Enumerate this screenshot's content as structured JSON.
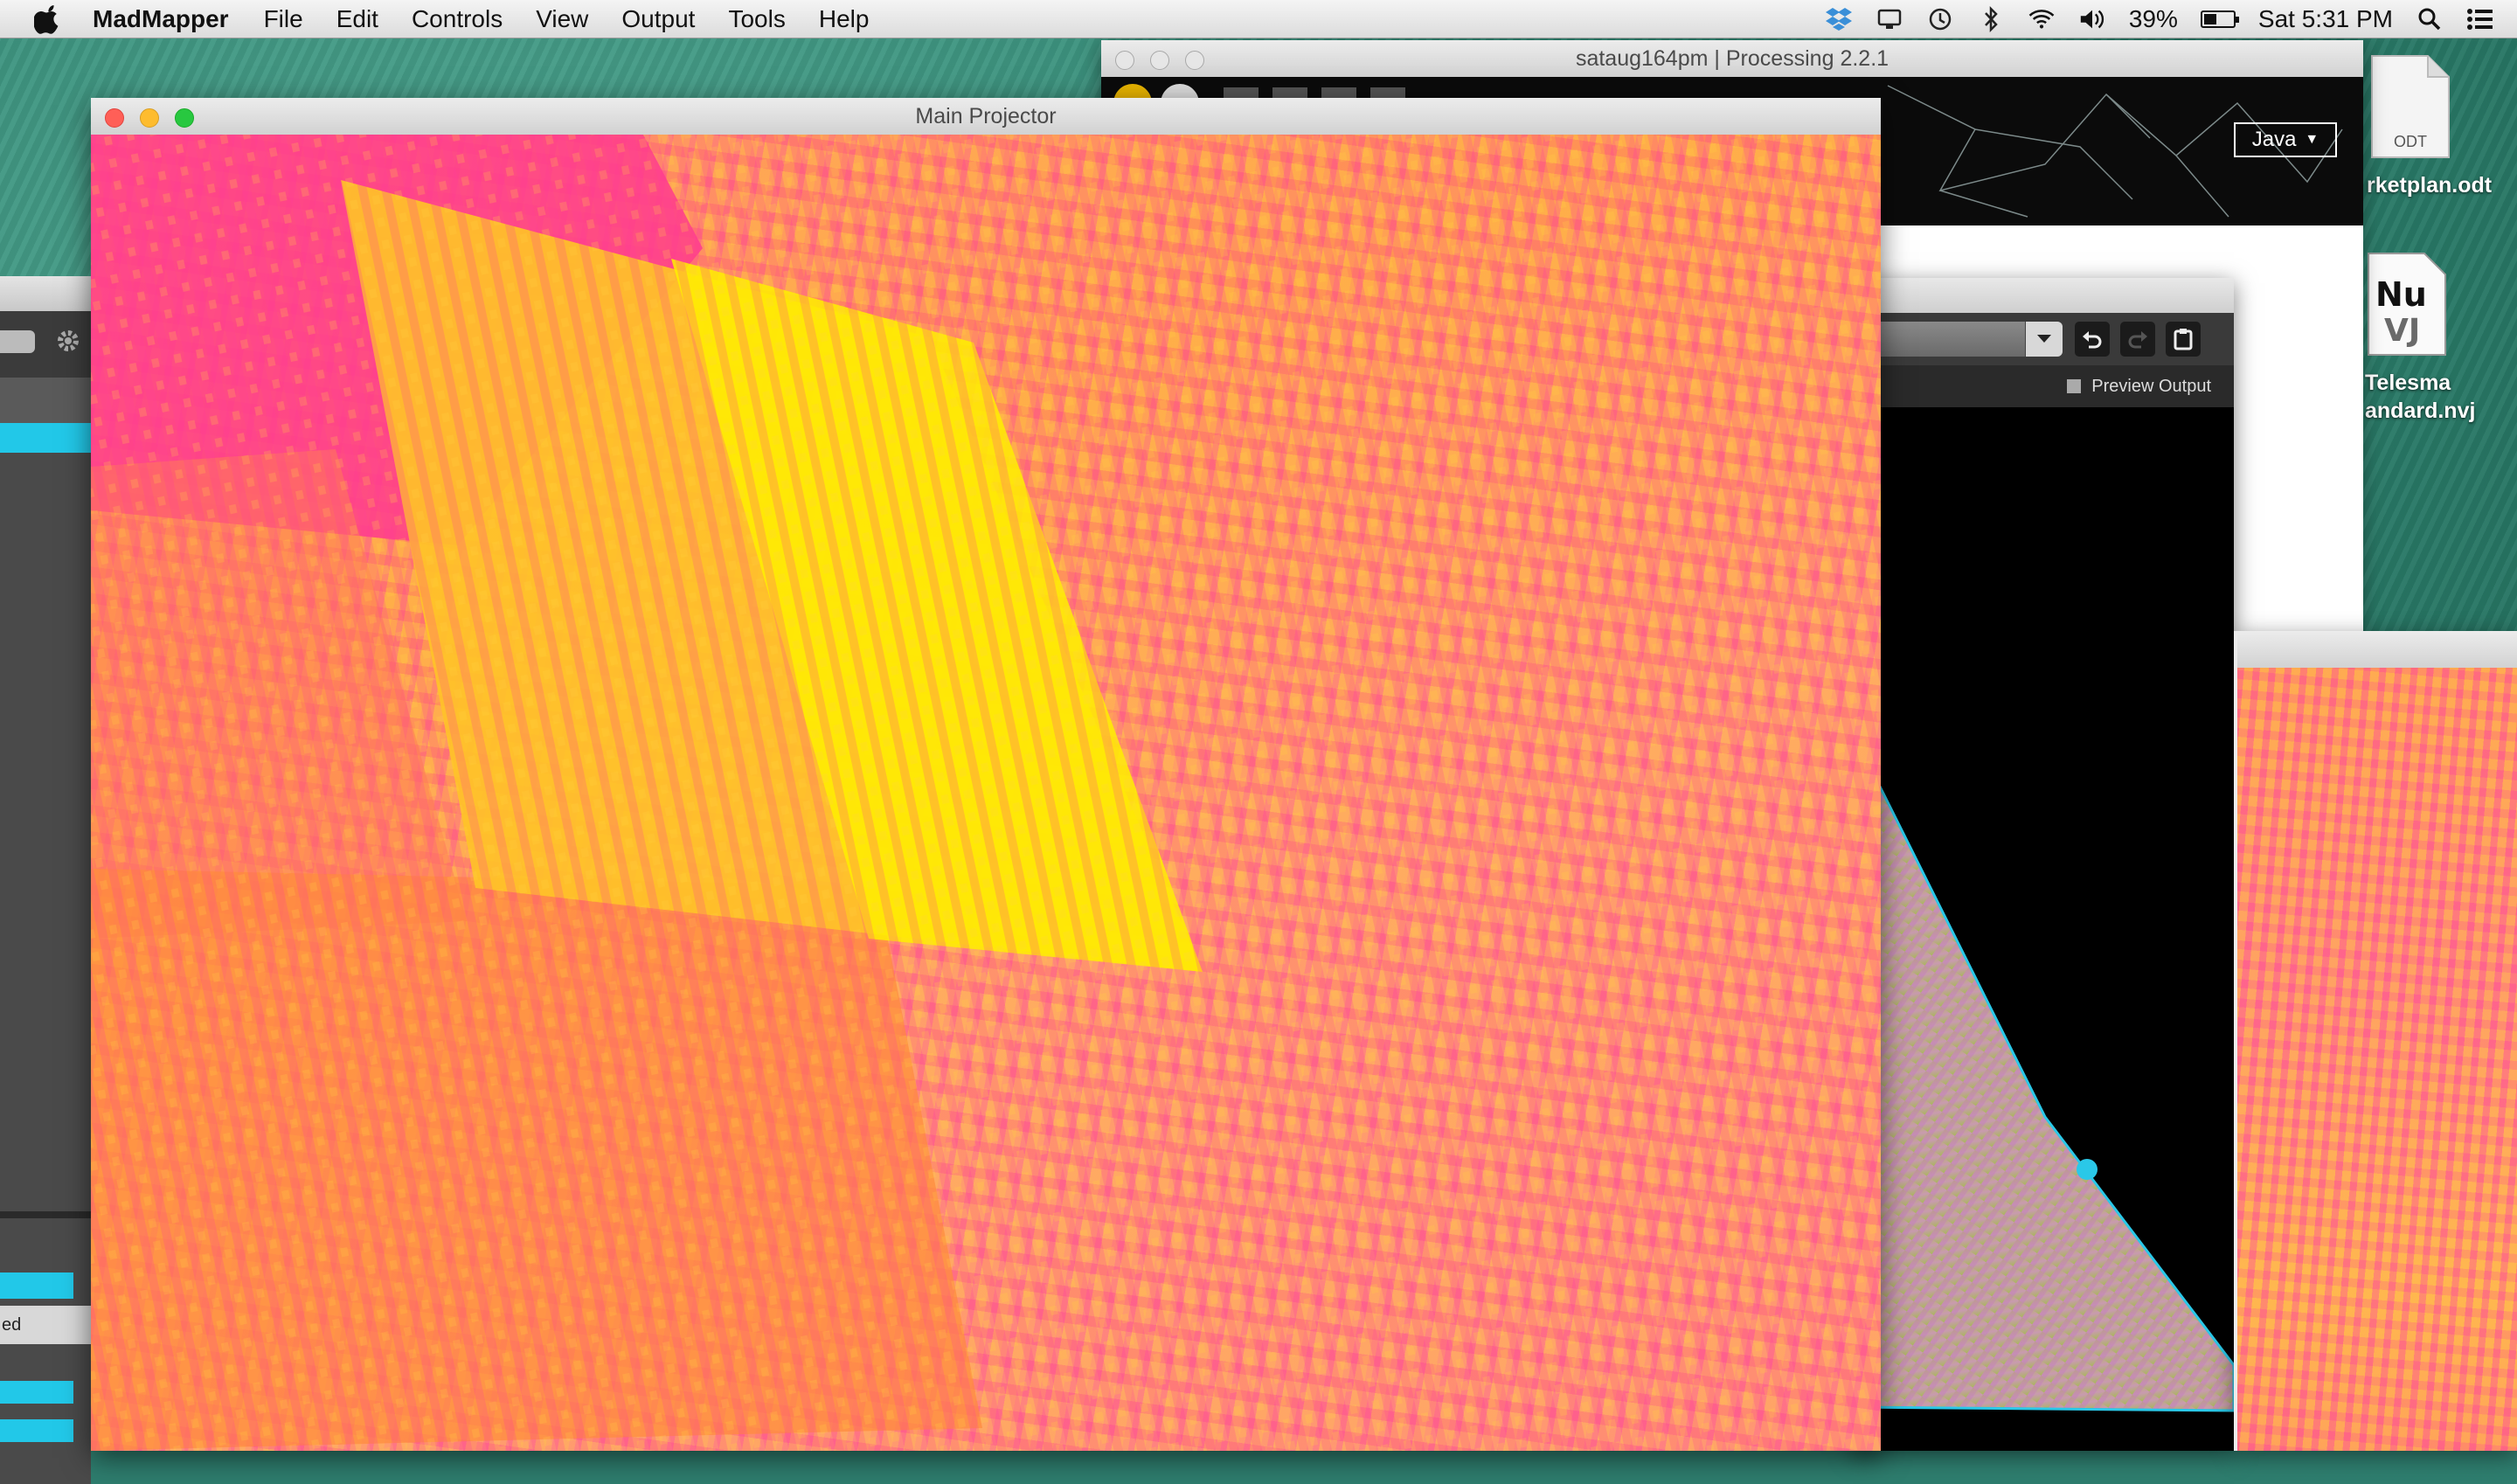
{
  "menubar": {
    "app_name": "MadMapper",
    "items": [
      "File",
      "Edit",
      "Controls",
      "View",
      "Output",
      "Tools",
      "Help"
    ],
    "battery_percent": "39%",
    "clock": "Sat 5:31 PM"
  },
  "processing_window": {
    "title": "sataug164pm | Processing 2.2.1",
    "mode_label": "Java"
  },
  "main_projector": {
    "title": "Main Projector"
  },
  "madmapper_window": {
    "preview_label": "Preview Output"
  },
  "left_panel": {
    "partial_label": "ed"
  },
  "desktop_icons": [
    {
      "badge": "ODT",
      "label": "rketplan.odt"
    },
    {
      "badge": "NuVJ",
      "label_line1": "Telesma",
      "label_line2": "andard.nvj"
    }
  ],
  "colors": {
    "accent_cyan": "#22c8e8",
    "projector_hot_pink": "#ff3c8c",
    "projector_yellow": "#ffee00",
    "projector_orange": "#ff9a3c"
  }
}
